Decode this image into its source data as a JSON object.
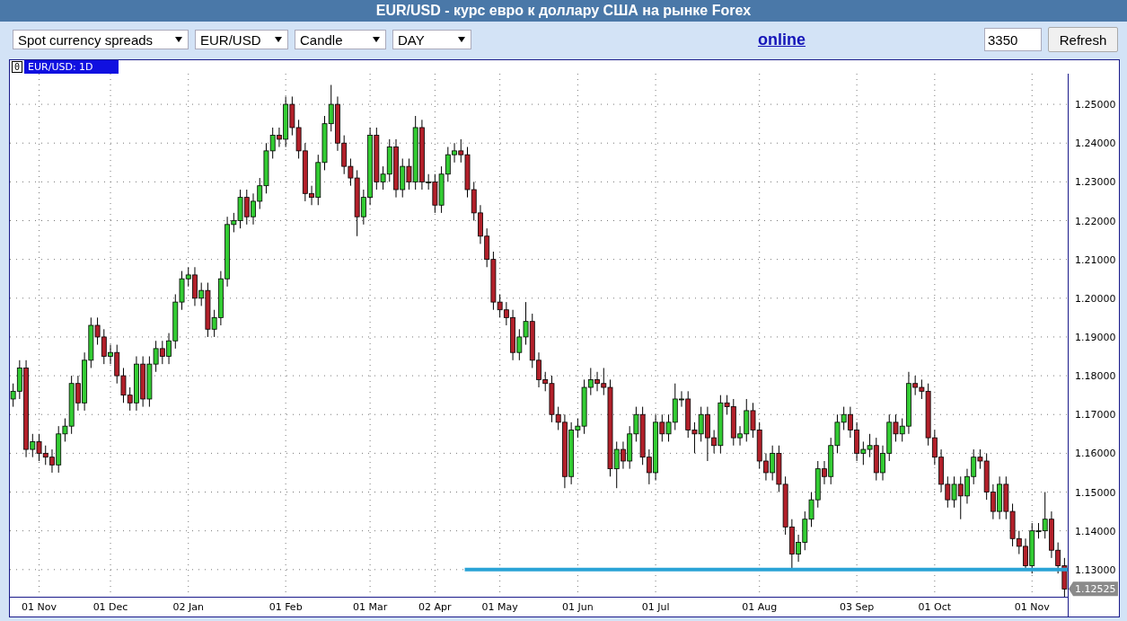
{
  "header": {
    "title": "EUR/USD - курс евро к доллару США на рынке Forex"
  },
  "toolbar": {
    "dropdowns": [
      {
        "value": "Spot currency spreads"
      },
      {
        "value": "EUR/USD"
      },
      {
        "value": "Candle"
      },
      {
        "value": "DAY"
      }
    ],
    "link": "online",
    "field": {
      "value": "3350"
    },
    "button": "Refresh"
  },
  "chart": {
    "window_number": "0",
    "price_tag": "1.12525",
    "chart_data": {
      "type": "candlestick",
      "title": "EUR/USD: 1D",
      "grid": true,
      "categories": [
        null,
        null,
        null,
        null,
        "01 Nov",
        null,
        null,
        null,
        null,
        null,
        null,
        null,
        null,
        null,
        null,
        "01 Dec",
        null,
        null,
        null,
        null,
        null,
        null,
        null,
        null,
        null,
        null,
        null,
        "02 Jan",
        null,
        null,
        null,
        null,
        null,
        null,
        null,
        null,
        null,
        null,
        null,
        null,
        null,
        null,
        "01 Feb",
        null,
        null,
        null,
        null,
        null,
        null,
        null,
        null,
        null,
        null,
        null,
        null,
        "01 Mar",
        null,
        null,
        null,
        null,
        null,
        null,
        null,
        null,
        null,
        "02 Apr",
        null,
        null,
        null,
        null,
        null,
        null,
        null,
        null,
        null,
        "01 May",
        null,
        null,
        null,
        null,
        null,
        null,
        null,
        null,
        null,
        null,
        null,
        "01 Jun",
        null,
        null,
        null,
        null,
        null,
        null,
        null,
        null,
        null,
        null,
        null,
        "01 Jul",
        null,
        null,
        null,
        null,
        null,
        null,
        null,
        null,
        null,
        null,
        null,
        null,
        null,
        null,
        null,
        "01 Aug",
        null,
        null,
        null,
        null,
        null,
        null,
        null,
        null,
        null,
        null,
        null,
        null,
        null,
        null,
        "03 Sep",
        null,
        null,
        null,
        null,
        null,
        null,
        null,
        null,
        null,
        null,
        null,
        "01 Oct",
        null,
        null,
        null,
        null,
        null,
        null,
        null,
        null,
        null,
        null,
        null,
        null,
        null,
        null,
        "01 Nov",
        null,
        null,
        null,
        null,
        null
      ],
      "ohlc": [
        [
          1.174,
          1.178,
          1.172,
          1.176
        ],
        [
          1.176,
          1.184,
          1.174,
          1.182
        ],
        [
          1.182,
          1.184,
          1.159,
          1.161
        ],
        [
          1.161,
          1.165,
          1.159,
          1.163
        ],
        [
          1.163,
          1.165,
          1.158,
          1.16
        ],
        [
          1.16,
          1.162,
          1.157,
          1.159
        ],
        [
          1.159,
          1.161,
          1.155,
          1.157
        ],
        [
          1.157,
          1.167,
          1.155,
          1.165
        ],
        [
          1.165,
          1.169,
          1.163,
          1.167
        ],
        [
          1.167,
          1.18,
          1.165,
          1.178
        ],
        [
          1.178,
          1.18,
          1.171,
          1.173
        ],
        [
          1.173,
          1.186,
          1.171,
          1.184
        ],
        [
          1.184,
          1.195,
          1.182,
          1.193
        ],
        [
          1.193,
          1.195,
          1.188,
          1.19
        ],
        [
          1.19,
          1.192,
          1.183,
          1.185
        ],
        [
          1.185,
          1.188,
          1.183,
          1.186
        ],
        [
          1.186,
          1.188,
          1.178,
          1.18
        ],
        [
          1.18,
          1.182,
          1.173,
          1.175
        ],
        [
          1.175,
          1.177,
          1.171,
          1.173
        ],
        [
          1.173,
          1.185,
          1.171,
          1.183
        ],
        [
          1.183,
          1.185,
          1.172,
          1.174
        ],
        [
          1.174,
          1.185,
          1.172,
          1.183
        ],
        [
          1.183,
          1.189,
          1.181,
          1.187
        ],
        [
          1.187,
          1.189,
          1.183,
          1.185
        ],
        [
          1.185,
          1.191,
          1.183,
          1.189
        ],
        [
          1.189,
          1.201,
          1.187,
          1.199
        ],
        [
          1.199,
          1.207,
          1.197,
          1.205
        ],
        [
          1.205,
          1.208,
          1.203,
          1.206
        ],
        [
          1.206,
          1.208,
          1.198,
          1.2
        ],
        [
          1.2,
          1.204,
          1.198,
          1.202
        ],
        [
          1.202,
          1.204,
          1.19,
          1.192
        ],
        [
          1.192,
          1.197,
          1.19,
          1.195
        ],
        [
          1.195,
          1.207,
          1.193,
          1.205
        ],
        [
          1.205,
          1.221,
          1.203,
          1.219
        ],
        [
          1.219,
          1.222,
          1.217,
          1.22
        ],
        [
          1.22,
          1.228,
          1.218,
          1.226
        ],
        [
          1.226,
          1.228,
          1.219,
          1.221
        ],
        [
          1.221,
          1.227,
          1.219,
          1.225
        ],
        [
          1.225,
          1.231,
          1.223,
          1.229
        ],
        [
          1.229,
          1.24,
          1.227,
          1.238
        ],
        [
          1.238,
          1.244,
          1.236,
          1.242
        ],
        [
          1.242,
          1.244,
          1.239,
          1.241
        ],
        [
          1.241,
          1.252,
          1.239,
          1.25
        ],
        [
          1.25,
          1.252,
          1.242,
          1.244
        ],
        [
          1.244,
          1.246,
          1.236,
          1.238
        ],
        [
          1.238,
          1.24,
          1.225,
          1.227
        ],
        [
          1.227,
          1.229,
          1.224,
          1.226
        ],
        [
          1.226,
          1.237,
          1.224,
          1.235
        ],
        [
          1.235,
          1.247,
          1.233,
          1.245
        ],
        [
          1.245,
          1.255,
          1.243,
          1.25
        ],
        [
          1.25,
          1.252,
          1.238,
          1.24
        ],
        [
          1.24,
          1.242,
          1.232,
          1.234
        ],
        [
          1.234,
          1.236,
          1.229,
          1.231
        ],
        [
          1.231,
          1.233,
          1.216,
          1.221
        ],
        [
          1.221,
          1.228,
          1.219,
          1.226
        ],
        [
          1.226,
          1.244,
          1.224,
          1.242
        ],
        [
          1.242,
          1.244,
          1.228,
          1.23
        ],
        [
          1.23,
          1.234,
          1.228,
          1.232
        ],
        [
          1.232,
          1.241,
          1.23,
          1.239
        ],
        [
          1.239,
          1.241,
          1.226,
          1.228
        ],
        [
          1.228,
          1.236,
          1.226,
          1.234
        ],
        [
          1.234,
          1.236,
          1.228,
          1.23
        ],
        [
          1.23,
          1.247,
          1.228,
          1.244
        ],
        [
          1.244,
          1.246,
          1.228,
          1.23
        ],
        [
          1.23,
          1.232,
          1.228,
          1.23
        ],
        [
          1.23,
          1.232,
          1.222,
          1.224
        ],
        [
          1.224,
          1.234,
          1.222,
          1.232
        ],
        [
          1.232,
          1.239,
          1.23,
          1.237
        ],
        [
          1.237,
          1.24,
          1.235,
          1.238
        ],
        [
          1.238,
          1.241,
          1.235,
          1.237
        ],
        [
          1.237,
          1.239,
          1.226,
          1.228
        ],
        [
          1.228,
          1.23,
          1.22,
          1.222
        ],
        [
          1.222,
          1.224,
          1.214,
          1.216
        ],
        [
          1.216,
          1.218,
          1.208,
          1.21
        ],
        [
          1.21,
          1.212,
          1.197,
          1.199
        ],
        [
          1.199,
          1.201,
          1.195,
          1.197
        ],
        [
          1.197,
          1.199,
          1.193,
          1.195
        ],
        [
          1.195,
          1.197,
          1.184,
          1.186
        ],
        [
          1.186,
          1.192,
          1.184,
          1.19
        ],
        [
          1.19,
          1.199,
          1.188,
          1.194
        ],
        [
          1.194,
          1.196,
          1.182,
          1.184
        ],
        [
          1.184,
          1.186,
          1.177,
          1.179
        ],
        [
          1.179,
          1.181,
          1.176,
          1.178
        ],
        [
          1.178,
          1.18,
          1.168,
          1.17
        ],
        [
          1.17,
          1.172,
          1.166,
          1.168
        ],
        [
          1.168,
          1.17,
          1.151,
          1.154
        ],
        [
          1.154,
          1.168,
          1.152,
          1.166
        ],
        [
          1.166,
          1.169,
          1.164,
          1.167
        ],
        [
          1.167,
          1.179,
          1.165,
          1.177
        ],
        [
          1.177,
          1.182,
          1.175,
          1.179
        ],
        [
          1.179,
          1.181,
          1.176,
          1.178
        ],
        [
          1.178,
          1.182,
          1.175,
          1.177
        ],
        [
          1.177,
          1.179,
          1.154,
          1.156
        ],
        [
          1.156,
          1.163,
          1.151,
          1.161
        ],
        [
          1.161,
          1.163,
          1.156,
          1.158
        ],
        [
          1.158,
          1.167,
          1.156,
          1.165
        ],
        [
          1.165,
          1.172,
          1.163,
          1.17
        ],
        [
          1.17,
          1.172,
          1.157,
          1.159
        ],
        [
          1.159,
          1.161,
          1.152,
          1.155
        ],
        [
          1.155,
          1.17,
          1.153,
          1.168
        ],
        [
          1.168,
          1.17,
          1.163,
          1.165
        ],
        [
          1.165,
          1.17,
          1.163,
          1.168
        ],
        [
          1.168,
          1.178,
          1.166,
          1.174
        ],
        [
          1.174,
          1.176,
          1.172,
          1.174
        ],
        [
          1.174,
          1.176,
          1.164,
          1.166
        ],
        [
          1.166,
          1.168,
          1.16,
          1.165
        ],
        [
          1.165,
          1.172,
          1.163,
          1.17
        ],
        [
          1.17,
          1.172,
          1.158,
          1.164
        ],
        [
          1.164,
          1.166,
          1.16,
          1.162
        ],
        [
          1.162,
          1.175,
          1.16,
          1.173
        ],
        [
          1.173,
          1.175,
          1.17,
          1.172
        ],
        [
          1.172,
          1.174,
          1.162,
          1.164
        ],
        [
          1.164,
          1.167,
          1.162,
          1.165
        ],
        [
          1.165,
          1.174,
          1.163,
          1.171
        ],
        [
          1.171,
          1.173,
          1.164,
          1.166
        ],
        [
          1.166,
          1.168,
          1.156,
          1.158
        ],
        [
          1.158,
          1.16,
          1.153,
          1.155
        ],
        [
          1.155,
          1.162,
          1.153,
          1.16
        ],
        [
          1.16,
          1.162,
          1.15,
          1.152
        ],
        [
          1.152,
          1.154,
          1.139,
          1.141
        ],
        [
          1.141,
          1.143,
          1.13,
          1.134
        ],
        [
          1.134,
          1.139,
          1.132,
          1.137
        ],
        [
          1.137,
          1.145,
          1.135,
          1.143
        ],
        [
          1.143,
          1.15,
          1.141,
          1.148
        ],
        [
          1.148,
          1.158,
          1.146,
          1.156
        ],
        [
          1.156,
          1.158,
          1.152,
          1.154
        ],
        [
          1.154,
          1.164,
          1.152,
          1.162
        ],
        [
          1.162,
          1.17,
          1.16,
          1.168
        ],
        [
          1.168,
          1.172,
          1.166,
          1.17
        ],
        [
          1.17,
          1.172,
          1.164,
          1.166
        ],
        [
          1.166,
          1.168,
          1.158,
          1.16
        ],
        [
          1.16,
          1.163,
          1.157,
          1.161
        ],
        [
          1.161,
          1.165,
          1.159,
          1.162
        ],
        [
          1.162,
          1.164,
          1.153,
          1.155
        ],
        [
          1.155,
          1.162,
          1.153,
          1.16
        ],
        [
          1.16,
          1.17,
          1.158,
          1.168
        ],
        [
          1.168,
          1.17,
          1.163,
          1.165
        ],
        [
          1.165,
          1.169,
          1.163,
          1.167
        ],
        [
          1.167,
          1.181,
          1.165,
          1.178
        ],
        [
          1.178,
          1.18,
          1.175,
          1.177
        ],
        [
          1.177,
          1.179,
          1.174,
          1.176
        ],
        [
          1.176,
          1.178,
          1.162,
          1.164
        ],
        [
          1.164,
          1.166,
          1.157,
          1.159
        ],
        [
          1.159,
          1.161,
          1.15,
          1.152
        ],
        [
          1.152,
          1.154,
          1.146,
          1.148
        ],
        [
          1.148,
          1.154,
          1.146,
          1.152
        ],
        [
          1.152,
          1.154,
          1.143,
          1.149
        ],
        [
          1.149,
          1.156,
          1.147,
          1.154
        ],
        [
          1.154,
          1.161,
          1.152,
          1.159
        ],
        [
          1.159,
          1.161,
          1.156,
          1.158
        ],
        [
          1.158,
          1.16,
          1.148,
          1.15
        ],
        [
          1.15,
          1.152,
          1.143,
          1.145
        ],
        [
          1.145,
          1.154,
          1.143,
          1.152
        ],
        [
          1.152,
          1.154,
          1.143,
          1.145
        ],
        [
          1.145,
          1.147,
          1.136,
          1.138
        ],
        [
          1.138,
          1.14,
          1.134,
          1.136
        ],
        [
          1.136,
          1.138,
          1.13,
          1.131
        ],
        [
          1.131,
          1.142,
          1.129,
          1.14
        ],
        [
          1.14,
          1.142,
          1.138,
          1.14
        ],
        [
          1.14,
          1.15,
          1.138,
          1.143
        ],
        [
          1.143,
          1.145,
          1.133,
          1.135
        ],
        [
          1.135,
          1.137,
          1.129,
          1.131
        ],
        [
          1.131,
          1.133,
          1.123,
          1.125
        ]
      ],
      "ylim": [
        1.123,
        1.2579
      ],
      "yticks": [
        {
          "value": 1.13,
          "label": "1.13000"
        },
        {
          "value": 1.14,
          "label": "1.14000"
        },
        {
          "value": 1.15,
          "label": "1.15000"
        },
        {
          "value": 1.16,
          "label": "1.16000"
        },
        {
          "value": 1.17,
          "label": "1.17000"
        },
        {
          "value": 1.18,
          "label": "1.18000"
        },
        {
          "value": 1.19,
          "label": "1.19000"
        },
        {
          "value": 1.2,
          "label": "1.20000"
        },
        {
          "value": 1.21,
          "label": "1.21000"
        },
        {
          "value": 1.22,
          "label": "1.22000"
        },
        {
          "value": 1.23,
          "label": "1.23000"
        },
        {
          "value": 1.24,
          "label": "1.24000"
        },
        {
          "value": 1.25,
          "label": "1.25000"
        }
      ],
      "ref_lines": [
        {
          "axis": "y",
          "value": 1.13,
          "color": "#2aa3d6"
        }
      ]
    }
  }
}
